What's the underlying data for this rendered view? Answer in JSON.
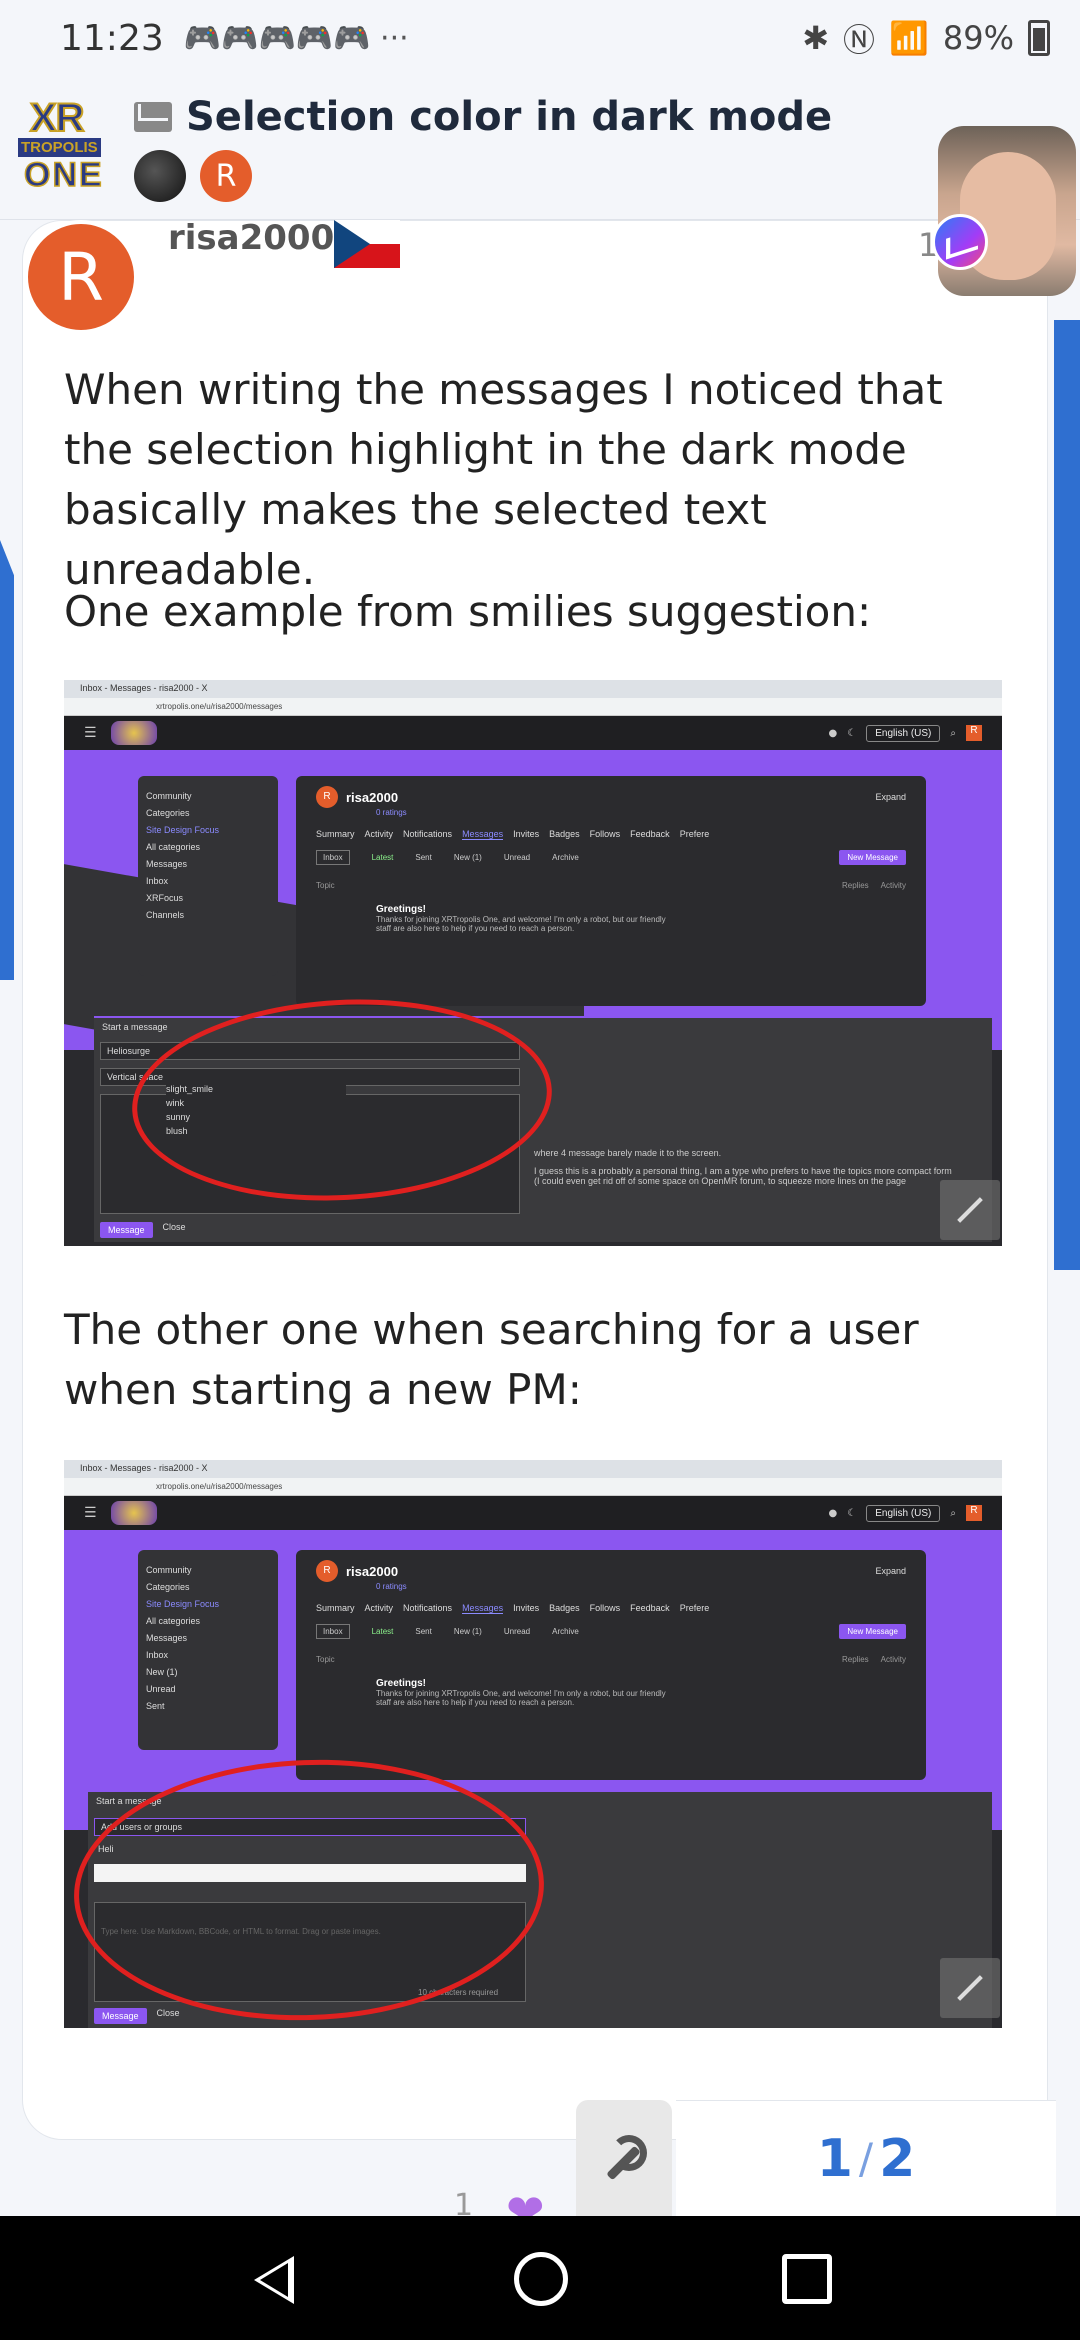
{
  "status_bar": {
    "time": "11:23",
    "notification_icons": "🎮🎮🎮🎮🎮 ···",
    "battery": "89%"
  },
  "header": {
    "logo_text": {
      "xr": "XR",
      "tropolis": "TROPOLIS",
      "one": "ONE"
    },
    "title": "Selection color in dark mode",
    "participant_initial": "R"
  },
  "post": {
    "avatar_initial": "R",
    "username": "risa2000",
    "post_number": "1",
    "paragraph1": "When writing the messages I noticed that the selection highlight in the dark mode basically makes the selected text unreadable.",
    "paragraph2": "One example from smilies suggestion:",
    "paragraph3": "The other one when searching for a user when starting a new PM:"
  },
  "screenshot1": {
    "tab": "Inbox - Messages - risa2000 - X",
    "url": "xrtropolis.one/u/risa2000/messages",
    "language": "English (US)",
    "user_initial": "R",
    "sidebar": [
      "Community",
      "Categories",
      "Site Design Focus",
      "All categories",
      "Messages",
      "Inbox",
      "XRFocus",
      "Channels"
    ],
    "panel_name": "risa2000",
    "expand": "Expand",
    "ratings": "0 ratings",
    "tabs": [
      "Summary",
      "Activity",
      "Notifications",
      "Messages",
      "Invites",
      "Badges",
      "Follows",
      "Feedback",
      "Prefere"
    ],
    "subtabs": [
      "Inbox",
      "Latest",
      "Sent",
      "New (1)",
      "Unread",
      "Archive"
    ],
    "new_message": "New Message",
    "topic_header": "Topic",
    "replies": "Replies",
    "activity": "Activity",
    "greeting": "Greetings!",
    "greeting_text": "Thanks for joining XRTropolis One, and welcome! I'm only a robot, but our friendly staff are also here to help if you need to reach a person.",
    "composer_title": "Start a message",
    "field1": "Heliosurge",
    "field2": "Vertical space",
    "emoji_list": [
      "slight_smile",
      "",
      "wink",
      "sunny",
      "blush"
    ],
    "preview_text": "where 4 message barely made it to the screen.",
    "preview_body": "I guess this is a probably a personal thing, I am a type who prefers to have the topics more compact form (I could even get rid off of some space on OpenMR forum, to squeeze more lines on the page",
    "message_btn": "Message",
    "close_btn": "Close"
  },
  "screenshot2": {
    "tab": "Inbox - Messages - risa2000 - X",
    "url": "xrtropolis.one/u/risa2000/messages",
    "language": "English (US)",
    "user_initial": "R",
    "sidebar": [
      "Community",
      "Categories",
      "Site Design Focus",
      "All categories",
      "Messages",
      "Inbox",
      "New (1)",
      "Unread",
      "Sent"
    ],
    "panel_name": "risa2000",
    "expand": "Expand",
    "ratings": "0 ratings",
    "tabs": [
      "Summary",
      "Activity",
      "Notifications",
      "Messages",
      "Invites",
      "Badges",
      "Follows",
      "Feedback",
      "Prefere"
    ],
    "subtabs": [
      "Inbox",
      "Latest",
      "Sent",
      "New (1)",
      "Unread",
      "Archive"
    ],
    "new_message": "New Message",
    "topic_header": "Topic",
    "replies": "Replies",
    "activity": "Activity",
    "greeting": "Greetings!",
    "greeting_text": "Thanks for joining XRTropolis One, and welcome! I'm only a robot, but our friendly staff are also here to help if you need to reach a person.",
    "composer_title": "Start a message",
    "add_users": "Add users or groups",
    "search_text": "Heli",
    "placeholder": "Type here. Use Markdown, BBCode, or HTML to format. Drag or paste images.",
    "chars_required": "10 characters required",
    "message_btn": "Message",
    "close_btn": "Close"
  },
  "footer": {
    "progress_current": "1",
    "progress_total": "2",
    "like_count": "1"
  },
  "colors": {
    "accent": "#2f6fd0",
    "avatar": "#e45d2b",
    "site_purple": "#8b56f0",
    "annotation_red": "#e0201f"
  }
}
